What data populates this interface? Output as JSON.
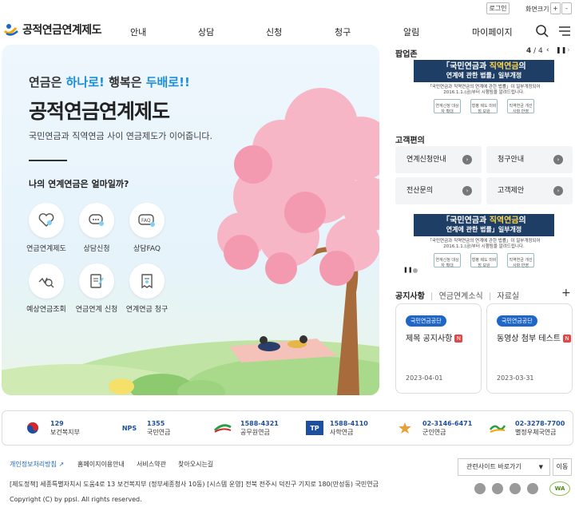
{
  "util": {
    "login": "로그인",
    "zoom_label": "화면크기",
    "zoom_in": "+",
    "zoom_out": "-"
  },
  "header": {
    "logo": "공적연금연계제도",
    "nav": [
      "안내",
      "상담",
      "신청",
      "청구",
      "알림",
      "마이페이지"
    ]
  },
  "hero": {
    "sub_prefix": "연금은 ",
    "sub_hl1": "하나로!",
    "sub_mid": " 행복은 ",
    "sub_hl2": "두배로!!",
    "title": "공적연금연계제도",
    "desc": "국민연금과 직역연금 사이 연금제도가 이어줍니다.",
    "question": "나의 연계연금은 얼마일까?",
    "services": [
      "연금연계제도",
      "상담신청",
      "상담FAQ",
      "예상연금조회",
      "연금연계 신청",
      "연계연금 청구"
    ],
    "service_icons": [
      "heart-speech-icon",
      "chat-bubble-icon",
      "faq-icon",
      "search-wave-icon",
      "edit-document-icon",
      "receipt-icon"
    ]
  },
  "popup": {
    "title": "팝업존",
    "page": "4",
    "total": "4",
    "banner_title_1a": "「국민연금",
    "banner_title_1b": "과 ",
    "banner_title_1c": "직역연금",
    "banner_title_1d": "의",
    "banner_title_2": "연계에 관한 법률」일부개정",
    "banner_desc_1": "「국민연금과 직역연금의 연계에 관한 법률」이 일부개정되어",
    "banner_desc_2": "2016.1.1.(금)부터 시행됨을 알려드립니다.",
    "banner_boxes": [
      "연계신청 대상자 확대",
      "형평 제도 미비점 보완",
      "직역연금 개선사항 반영"
    ]
  },
  "cs": {
    "title": "고객편의",
    "buttons": [
      "연계신청안내",
      "청구안내",
      "전산문의",
      "고객제안"
    ]
  },
  "notice": {
    "tabs": [
      "공지사항",
      "연금연계소식",
      "자료실"
    ],
    "more": "+",
    "cards": [
      {
        "badge": "국민연금공단",
        "title": "제목 공지사항",
        "new": "N",
        "date": "2023-04-01"
      },
      {
        "badge": "국민연금공단",
        "title": "동영상 첨부 테스트",
        "new": "N",
        "date": "2023-03-31"
      }
    ]
  },
  "partners": [
    {
      "num": "129",
      "name": "보건복지부"
    },
    {
      "num": "1355",
      "name": "국민연금"
    },
    {
      "num": "1588-4321",
      "name": "공무원연금"
    },
    {
      "num": "1588-4110",
      "name": "사학연금"
    },
    {
      "num": "02-3146-6471",
      "name": "군인연금"
    },
    {
      "num": "02-3278-7700",
      "name": "별정우체국연금"
    }
  ],
  "partner_logos": [
    "NPS",
    "TP"
  ],
  "footer": {
    "links": [
      "개인정보처리방침",
      "홈페이지이용안내",
      "서비스약관",
      "찾아오시는길"
    ],
    "related_sites": "관련사이트 바로가기",
    "go": "이동",
    "address": "[제도정책] 세종특별자치시 도움4로 13 보건복지부 (정부세종청사 10동)   [시스템 운영] 전북 전주시 덕진구 기지로 180(만성동) 국민연금",
    "copyright": "Copyright (C) by ppsl. All rights reserved.",
    "wa_mark": "WA"
  },
  "colors": {
    "accent_blue": "#1d8fd8",
    "nav_blue": "#1e66c8",
    "new_red": "#e64545",
    "banner_navy": "#1f3e66"
  }
}
